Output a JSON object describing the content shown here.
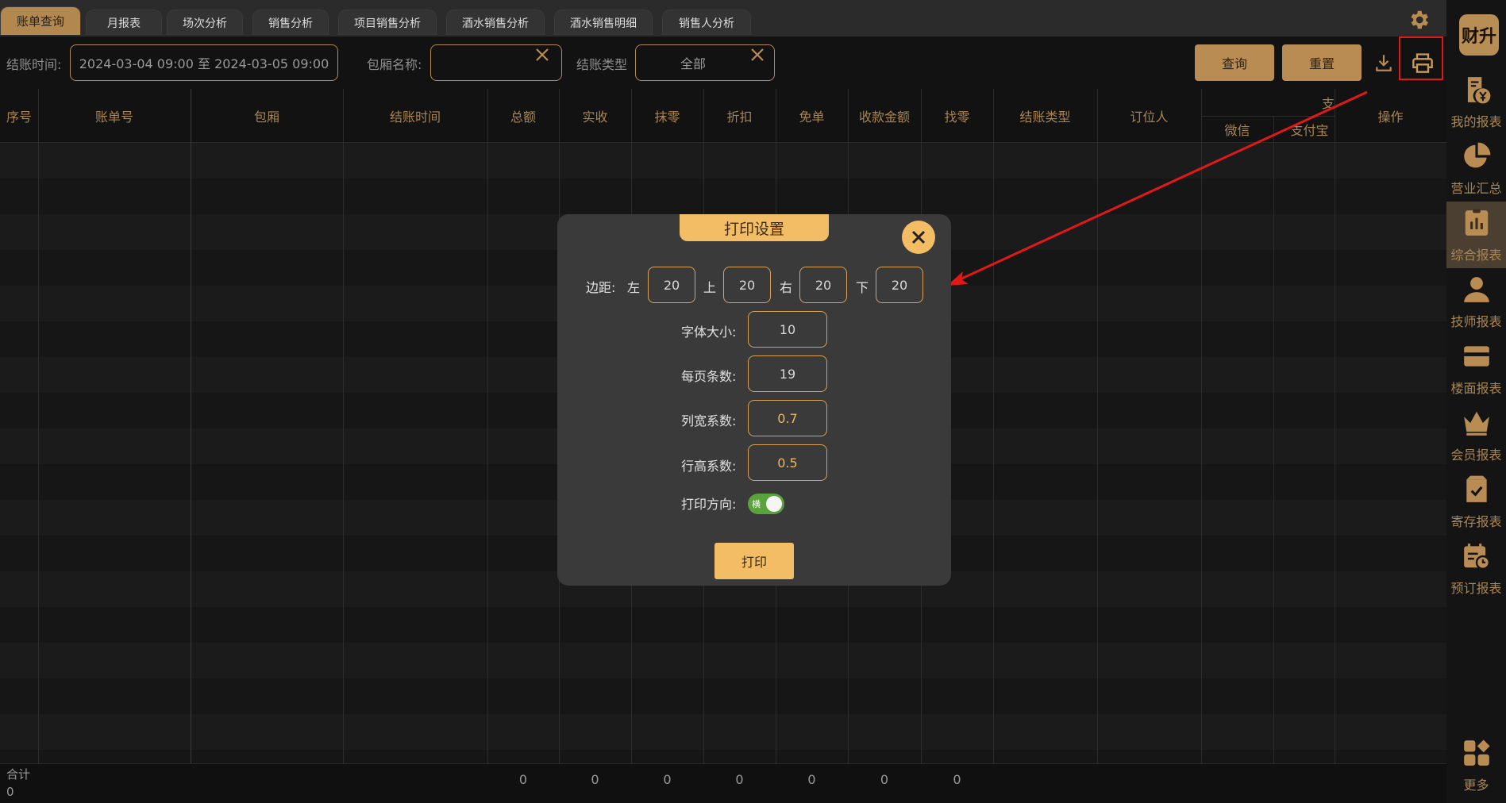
{
  "tabs": [
    {
      "label": "账单查询",
      "active": true
    },
    {
      "label": "月报表"
    },
    {
      "label": "场次分析"
    },
    {
      "label": "销售分析"
    },
    {
      "label": "项目销售分析"
    },
    {
      "label": "酒水销售分析"
    },
    {
      "label": "酒水销售明细"
    },
    {
      "label": "销售人分析"
    }
  ],
  "filters": {
    "time_label": "结账时间:",
    "time_value": "2024-03-04 09:00 至 2024-03-05 09:00",
    "room_label": "包厢名称:",
    "room_value": "",
    "type_label": "结账类型",
    "type_value": "全部",
    "query_button": "查询",
    "reset_button": "重置"
  },
  "table": {
    "headers": [
      "序号",
      "账单号",
      "包厢",
      "结账时间",
      "总额",
      "实收",
      "抹零",
      "折扣",
      "免单",
      "收款金额",
      "找零",
      "结账类型",
      "订位人",
      "支",
      "微信",
      "支付宝",
      "操作"
    ],
    "footer": {
      "total_label": "合计",
      "total_count": "0",
      "values": [
        "0",
        "0",
        "0",
        "0",
        "0",
        "0",
        "0"
      ]
    }
  },
  "sidebar": {
    "logo": "财升",
    "items": [
      {
        "label": "我的报表",
        "icon": "report-yen-icon"
      },
      {
        "label": "营业汇总",
        "icon": "pie-chart-icon"
      },
      {
        "label": "综合报表",
        "icon": "bar-chart-icon",
        "active": true
      },
      {
        "label": "技师报表",
        "icon": "person-icon"
      },
      {
        "label": "楼面报表",
        "icon": "card-icon"
      },
      {
        "label": "会员报表",
        "icon": "crown-icon"
      },
      {
        "label": "寄存报表",
        "icon": "storage-check-icon"
      },
      {
        "label": "预订报表",
        "icon": "calendar-clock-icon"
      },
      {
        "label": "更多",
        "icon": "more-grid-icon"
      }
    ]
  },
  "modal": {
    "title": "打印设置",
    "margin_label": "边距:",
    "left_label": "左",
    "left_value": "20",
    "top_label": "上",
    "top_value": "20",
    "right_label": "右",
    "right_value": "20",
    "bottom_label": "下",
    "bottom_value": "20",
    "font_size_label": "字体大小:",
    "font_size_value": "10",
    "rows_per_page_label": "每页条数:",
    "rows_per_page_value": "19",
    "col_width_label": "列宽系数:",
    "col_width_value": "0.7",
    "row_height_label": "行高系数:",
    "row_height_value": "0.5",
    "orientation_label": "打印方向:",
    "orientation_value": "横",
    "orientation_on": true,
    "print_button": "打印"
  },
  "colors": {
    "accent": "#f2bd64",
    "gold": "#b88c52",
    "annotation": "#e01818",
    "toggle_on": "#5aa33c"
  }
}
